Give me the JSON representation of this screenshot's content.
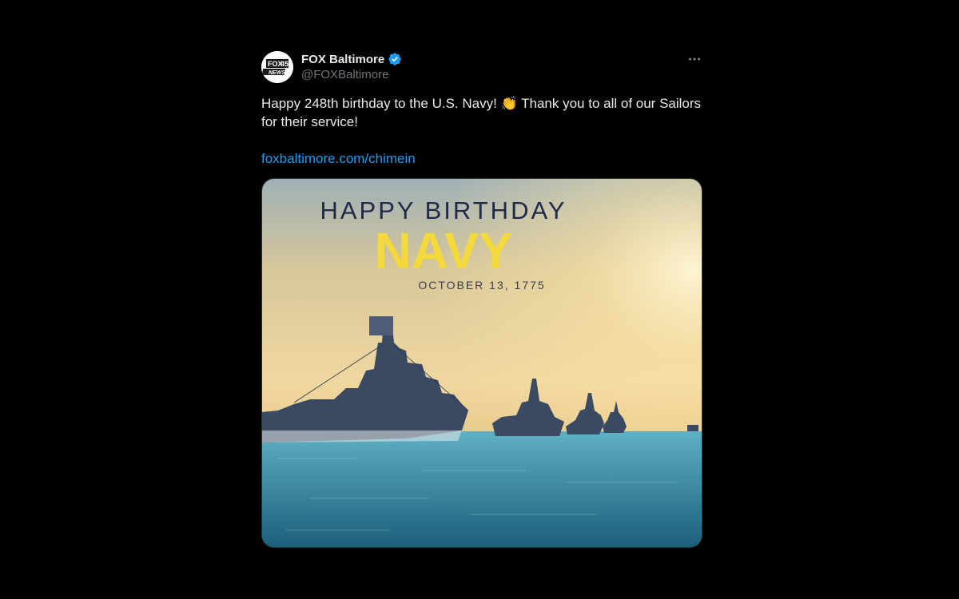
{
  "tweet": {
    "display_name": "FOX Baltimore",
    "handle": "@FOXBaltimore",
    "text": "Happy 248th birthday to the U.S. Navy! 👏 Thank you to all of our Sailors for their service!",
    "link": "foxbaltimore.com/chimein"
  },
  "avatar": {
    "line1": "FOX",
    "num": "45",
    "line2": "NEWS"
  },
  "media": {
    "headline": "HAPPY BIRTHDAY",
    "title": "NAVY",
    "date": "OCTOBER 13, 1775"
  },
  "colors": {
    "link": "#1d9bf0",
    "verified": "#1d9bf0",
    "title": "#f3d93b",
    "headline": "#1f2a4a"
  },
  "icons": {
    "verified": "verified-badge-icon",
    "more": "more-horizontal-icon"
  }
}
